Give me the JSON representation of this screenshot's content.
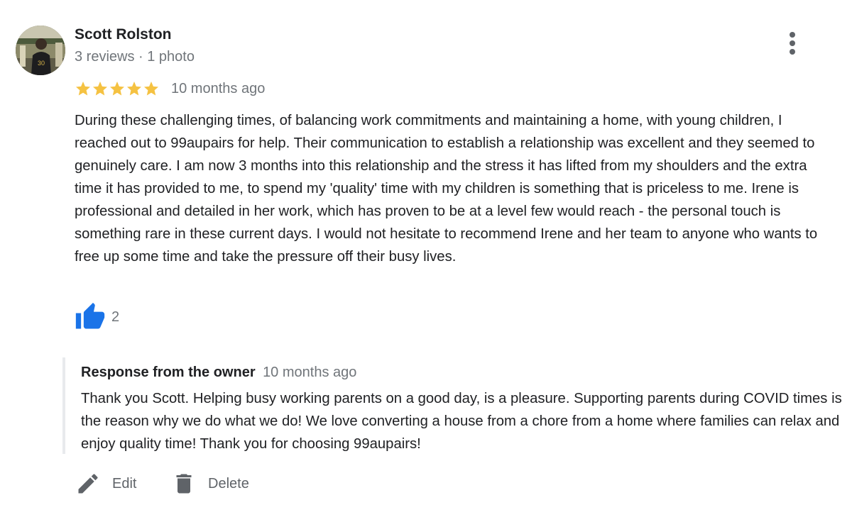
{
  "reviewer": {
    "name": "Scott Rolston",
    "meta": "3 reviews · 1 photo",
    "avatar_icon": "user-photo-avatar"
  },
  "review": {
    "rating": 5,
    "rating_max": 5,
    "star_color": "#f5c242",
    "date": "10 months ago",
    "text": "During these challenging times, of balancing work commitments and maintaining a home, with young children, I reached out to 99aupairs for help. Their communication to establish a relationship was excellent and they seemed to genuinely care. I am now 3 months into this relationship and the stress it has lifted from my shoulders and the extra time it has provided to me, to spend my 'quality' time with my children is something that is priceless to me. Irene is professional and detailed in her work, which has proven to be at a level few would reach - the personal touch is something rare in these current days. I would not hesitate to recommend Irene and her team to anyone who wants to free up some time and take the pressure off their busy lives.",
    "likes": "2",
    "like_icon": "thumbs-up-icon",
    "like_color": "#1a73e8"
  },
  "owner_response": {
    "title": "Response from the owner",
    "date": "10 months ago",
    "text": "Thank you Scott. Helping busy working parents on a good day, is a pleasure. Supporting parents during COVID times is the reason why we do what we do! We love converting a house from a chore from a home where families can relax and enjoy quality time! Thank you for choosing 99aupairs!"
  },
  "actions": {
    "edit_label": "Edit",
    "edit_icon": "pencil-icon",
    "delete_label": "Delete",
    "delete_icon": "trash-icon"
  },
  "menu": {
    "icon": "more-vert-icon"
  }
}
